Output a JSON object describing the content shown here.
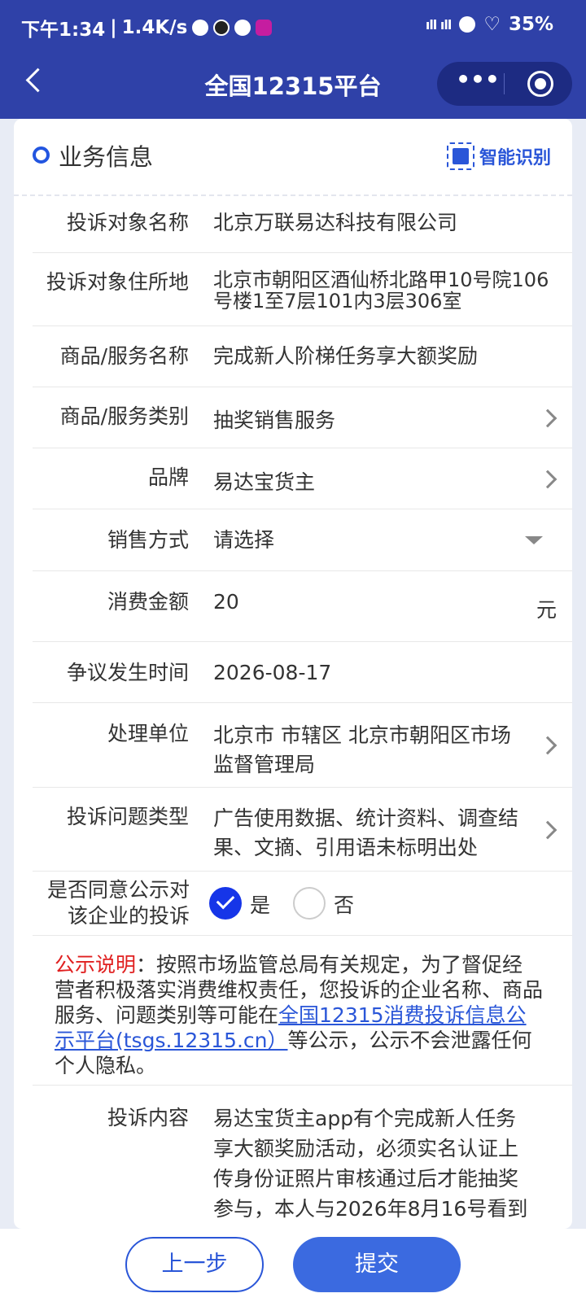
{
  "status_bar": {
    "time": "下午1:34",
    "speed": "1.4K/s",
    "battery": "35%",
    "signal": "ıll ıll"
  },
  "nav": {
    "title": "全国12315平台",
    "more": "•••"
  },
  "section": {
    "title": "业务信息",
    "smart_button": "智能识别"
  },
  "form": {
    "target_name": {
      "label": "投诉对象名称",
      "value": "北京万联易达科技有限公司"
    },
    "target_address": {
      "label": "投诉对象住所地",
      "value": "北京市朝阳区酒仙桥北路甲10号院106号楼1至7层101内3层306室"
    },
    "product_name": {
      "label": "商品/服务名称",
      "value": "完成新人阶梯任务享大额奖励"
    },
    "product_category": {
      "label": "商品/服务类别",
      "value": "抽奖销售服务"
    },
    "brand": {
      "label": "品牌",
      "value": "易达宝货主"
    },
    "sales_method": {
      "label": "销售方式",
      "placeholder": "请选择"
    },
    "amount": {
      "label": "消费金额",
      "value": "20",
      "unit": "元"
    },
    "dispute_date": {
      "label": "争议发生时间",
      "value": "2026-08-17"
    },
    "handling_unit": {
      "label": "处理单位",
      "value": "北京市 市辖区 北京市朝阳区市场监督管理局"
    },
    "issue_type": {
      "label": "投诉问题类型",
      "value": "广告使用数据、统计资料、调查结果、文摘、引用语未标明出处"
    },
    "publicity": {
      "label": "是否同意公示对该企业的投诉",
      "yes": "是",
      "no": "否",
      "selected": "是"
    },
    "complaint_content": {
      "label": "投诉内容",
      "value": "易达宝货主app有个完成新人任务享大额奖励活动，必须实名认证上传身份证照片审核通过后才能抽奖参与，本人与2026年8月16号看到"
    }
  },
  "notice": {
    "title": "公示说明",
    "text_before": "：按照市场监管总局有关规定，为了督促经营者积极落实消费维权责任，您投诉的企业名称、商品服务、问题类别等可能在",
    "link": "全国12315消费投诉信息公示平台(tsgs.12315.cn）",
    "text_after": "等公示，公示不会泄露任何个人隐私。"
  },
  "buttons": {
    "prev": "上一步",
    "submit": "提交"
  },
  "colors": {
    "header": "#2f41a8",
    "accent": "#2a56d8",
    "notice_title": "#e02020"
  }
}
